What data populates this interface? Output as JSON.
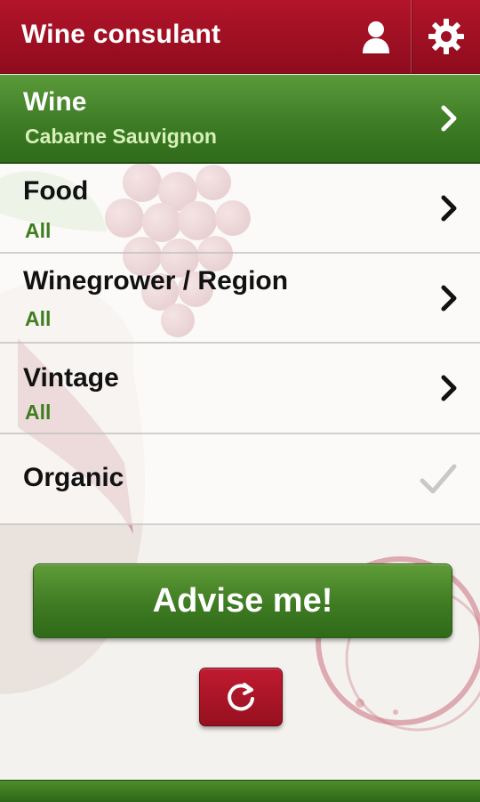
{
  "header": {
    "title": "Wine consulant",
    "user_icon": "user-icon",
    "settings_icon": "gear-icon"
  },
  "rows": [
    {
      "label": "Wine",
      "value": "Cabarne Sauvignon",
      "selected": true,
      "control": "chevron-right-icon"
    },
    {
      "label": "Food",
      "value": "All",
      "selected": false,
      "control": "chevron-right-icon"
    },
    {
      "label": "Winegrower / Region",
      "value": "All",
      "selected": false,
      "control": "chevron-right-icon"
    },
    {
      "label": "Vintage",
      "value": "All",
      "selected": false,
      "control": "chevron-right-icon"
    },
    {
      "label": "Organic",
      "checked": false,
      "control": "checkmark-icon"
    }
  ],
  "advise_button": {
    "label": "Advise me!"
  },
  "reset_button": {
    "icon": "refresh-icon"
  },
  "colors": {
    "header_red": "#a3122a",
    "accent_green": "#3f7b22",
    "value_green": "#3f7d1e"
  }
}
